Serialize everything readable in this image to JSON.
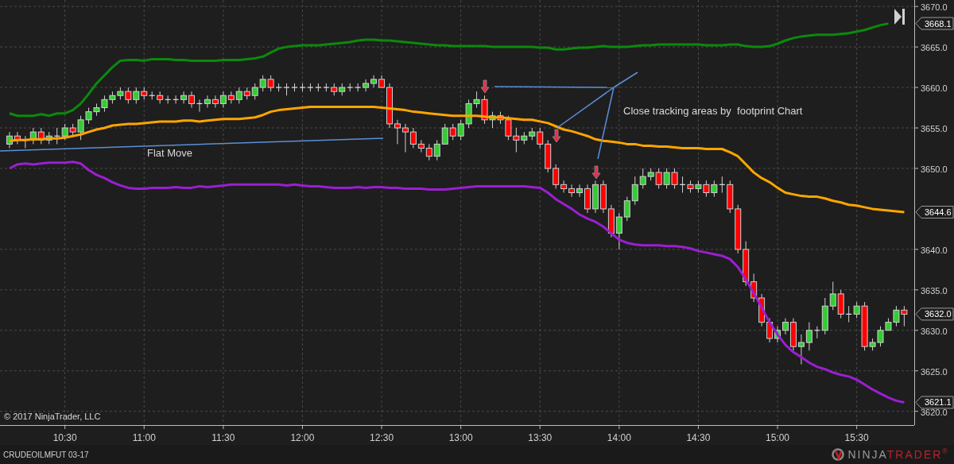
{
  "chart": {
    "copyright": "© 2017 NinjaTrader, LLC",
    "chart_data": {
      "type": "candlestick",
      "grid": true,
      "xlim": [
        605.4,
        951.8
      ],
      "ylim": [
        3618.3,
        3670.8
      ],
      "xticks": [
        {
          "value": 630,
          "label": "10:30"
        },
        {
          "value": 660,
          "label": "11:00"
        },
        {
          "value": 690,
          "label": "11:30"
        },
        {
          "value": 720,
          "label": "12:00"
        },
        {
          "value": 750,
          "label": "12:30"
        },
        {
          "value": 780,
          "label": "13:00"
        },
        {
          "value": 810,
          "label": "13:30"
        },
        {
          "value": 840,
          "label": "14:00"
        },
        {
          "value": 870,
          "label": "14:30"
        },
        {
          "value": 900,
          "label": "15:00"
        },
        {
          "value": 930,
          "label": "15:30"
        }
      ],
      "yticks": [
        {
          "value": 3620,
          "label": "3620.0"
        },
        {
          "value": 3625,
          "label": "3625.0"
        },
        {
          "value": 3630,
          "label": "3630.0"
        },
        {
          "value": 3635,
          "label": "3635.0"
        },
        {
          "value": 3640,
          "label": "3640.0"
        },
        {
          "value": 3650,
          "label": "3650.0"
        },
        {
          "value": 3655,
          "label": "3655.0"
        },
        {
          "value": 3660,
          "label": "3660.0"
        },
        {
          "value": 3665,
          "label": "3665.0"
        },
        {
          "value": 3670,
          "label": "3670.0"
        }
      ],
      "x": [
        609,
        612,
        615,
        618,
        621,
        624,
        627,
        630,
        633,
        636,
        639,
        642,
        645,
        648,
        651,
        654,
        657,
        660,
        663,
        666,
        669,
        672,
        675,
        678,
        681,
        684,
        687,
        690,
        693,
        696,
        699,
        702,
        705,
        708,
        711,
        714,
        717,
        720,
        723,
        726,
        729,
        732,
        735,
        738,
        741,
        744,
        747,
        750,
        753,
        756,
        759,
        762,
        765,
        768,
        771,
        774,
        777,
        780,
        783,
        786,
        789,
        792,
        795,
        798,
        801,
        804,
        807,
        810,
        813,
        816,
        819,
        822,
        825,
        828,
        831,
        834,
        837,
        840,
        843,
        846,
        849,
        852,
        855,
        858,
        861,
        864,
        867,
        870,
        873,
        876,
        879,
        882,
        885,
        888,
        891,
        894,
        897,
        900,
        903,
        906,
        909,
        912,
        915,
        918,
        921,
        924,
        927,
        930,
        933,
        936,
        939,
        942,
        945,
        948
      ],
      "ohlc": [
        [
          3653,
          3654.5,
          3652.5,
          3654
        ],
        [
          3654,
          3654.5,
          3653,
          3653.5
        ],
        [
          3653.5,
          3654,
          3652.5,
          3653.5
        ],
        [
          3653.5,
          3655,
          3653,
          3654.5
        ],
        [
          3654.5,
          3655,
          3653,
          3653.5
        ],
        [
          3653.5,
          3654.5,
          3653,
          3654
        ],
        [
          3654,
          3655,
          3653,
          3654
        ],
        [
          3654,
          3655.5,
          3653.5,
          3655
        ],
        [
          3655,
          3655.5,
          3654,
          3654.5
        ],
        [
          3654.5,
          3656.5,
          3653.5,
          3656
        ],
        [
          3656,
          3657.5,
          3655.5,
          3657
        ],
        [
          3657,
          3658,
          3656.5,
          3657.5
        ],
        [
          3657.5,
          3659,
          3657,
          3658.5
        ],
        [
          3658.5,
          3659.5,
          3658,
          3659
        ],
        [
          3659,
          3660,
          3658.5,
          3659.5
        ],
        [
          3659.5,
          3660,
          3658,
          3658.5
        ],
        [
          3658.5,
          3660,
          3658,
          3659.5
        ],
        [
          3659.5,
          3660,
          3658.5,
          3659
        ],
        [
          3659,
          3659.5,
          3658.5,
          3659
        ],
        [
          3659,
          3659.5,
          3658,
          3658.5
        ],
        [
          3658.5,
          3659,
          3658,
          3658.5
        ],
        [
          3658.5,
          3659,
          3658,
          3658.5
        ],
        [
          3658.5,
          3659.5,
          3658,
          3659
        ],
        [
          3659,
          3659.5,
          3657.5,
          3658
        ],
        [
          3658,
          3658.5,
          3657,
          3658
        ],
        [
          3658,
          3659,
          3657.5,
          3658.5
        ],
        [
          3658.5,
          3659,
          3657.5,
          3658
        ],
        [
          3658,
          3659.5,
          3657.5,
          3659
        ],
        [
          3659,
          3659.5,
          3658,
          3658.5
        ],
        [
          3658.5,
          3660,
          3658,
          3659.5
        ],
        [
          3659.5,
          3660,
          3658.5,
          3659
        ],
        [
          3659,
          3660.5,
          3658.5,
          3660
        ],
        [
          3660,
          3661.5,
          3659.5,
          3661
        ],
        [
          3661,
          3661.5,
          3659.5,
          3660
        ],
        [
          3660,
          3660.5,
          3659.5,
          3660
        ],
        [
          3660,
          3660.5,
          3659,
          3660
        ],
        [
          3660,
          3660.5,
          3659.5,
          3660
        ],
        [
          3660,
          3660.5,
          3659.5,
          3660
        ],
        [
          3660,
          3660.5,
          3659.5,
          3660
        ],
        [
          3660,
          3660.5,
          3659.5,
          3660
        ],
        [
          3660,
          3660.5,
          3659.5,
          3660
        ],
        [
          3660,
          3660.5,
          3659,
          3659.5
        ],
        [
          3659.5,
          3660.5,
          3659,
          3660
        ],
        [
          3660,
          3660.5,
          3659.5,
          3660
        ],
        [
          3660,
          3660.5,
          3659.5,
          3660
        ],
        [
          3660,
          3661,
          3659.5,
          3660.5
        ],
        [
          3660.5,
          3661.5,
          3660,
          3661
        ],
        [
          3661,
          3661.5,
          3660,
          3660
        ],
        [
          3660,
          3660.5,
          3655,
          3655.5
        ],
        [
          3655.5,
          3656,
          3653,
          3655
        ],
        [
          3655,
          3655.5,
          3652,
          3654.5
        ],
        [
          3654.5,
          3655,
          3652.5,
          3653
        ],
        [
          3653,
          3653.5,
          3652,
          3652.5
        ],
        [
          3652.5,
          3653,
          3651,
          3651.5
        ],
        [
          3651.5,
          3653.5,
          3651,
          3653
        ],
        [
          3653,
          3655.5,
          3653,
          3655
        ],
        [
          3655,
          3655.5,
          3653.5,
          3654
        ],
        [
          3654,
          3656,
          3653.5,
          3655.5
        ],
        [
          3655.5,
          3658.5,
          3655,
          3658
        ],
        [
          3658,
          3659.5,
          3657.5,
          3658.5
        ],
        [
          3658.5,
          3659,
          3655.5,
          3656
        ],
        [
          3656,
          3657,
          3655,
          3656.5
        ],
        [
          3656.5,
          3657,
          3655.5,
          3656
        ],
        [
          3656,
          3656.5,
          3653.5,
          3654
        ],
        [
          3654,
          3655,
          3652,
          3653.5
        ],
        [
          3653.5,
          3654.5,
          3653,
          3654
        ],
        [
          3654,
          3655,
          3653.5,
          3654.5
        ],
        [
          3654.5,
          3655,
          3652.5,
          3653
        ],
        [
          3653,
          3653.5,
          3649.5,
          3650
        ],
        [
          3650,
          3650.5,
          3647.5,
          3648
        ],
        [
          3648,
          3648.5,
          3647,
          3647.5
        ],
        [
          3647.5,
          3648,
          3646.5,
          3647
        ],
        [
          3647,
          3648,
          3646.5,
          3647.5
        ],
        [
          3647.5,
          3648,
          3644.5,
          3645
        ],
        [
          3645,
          3648.5,
          3644.5,
          3648
        ],
        [
          3648,
          3648.5,
          3644.5,
          3645
        ],
        [
          3645,
          3645.5,
          3641.5,
          3642
        ],
        [
          3642,
          3644.5,
          3640,
          3644
        ],
        [
          3644,
          3646.5,
          3643.5,
          3646
        ],
        [
          3646,
          3649,
          3645.5,
          3648
        ],
        [
          3648,
          3650,
          3647.5,
          3649
        ],
        [
          3649,
          3650,
          3648.5,
          3649.5
        ],
        [
          3649.5,
          3650,
          3647.5,
          3648
        ],
        [
          3648,
          3650,
          3647.5,
          3649.5
        ],
        [
          3649.5,
          3650,
          3647.5,
          3648
        ],
        [
          3648,
          3649,
          3647,
          3648
        ],
        [
          3648,
          3648.5,
          3647,
          3647.5
        ],
        [
          3647.5,
          3648.5,
          3647,
          3648
        ],
        [
          3648,
          3648.5,
          3646.5,
          3647
        ],
        [
          3647,
          3648.5,
          3646.5,
          3648
        ],
        [
          3648,
          3649,
          3647,
          3648
        ],
        [
          3648,
          3648.5,
          3644.5,
          3645
        ],
        [
          3645,
          3645.5,
          3639.5,
          3640
        ],
        [
          3640,
          3641,
          3635.5,
          3636
        ],
        [
          3636,
          3637,
          3633.5,
          3634
        ],
        [
          3634,
          3634.5,
          3630.5,
          3631
        ],
        [
          3631,
          3631.5,
          3628.5,
          3629
        ],
        [
          3629,
          3630.5,
          3628.5,
          3630
        ],
        [
          3630,
          3631.5,
          3629.5,
          3631
        ],
        [
          3631,
          3631.5,
          3627.5,
          3628
        ],
        [
          3628,
          3629.5,
          3625.8,
          3628.5
        ],
        [
          3628.5,
          3631,
          3627.5,
          3630
        ],
        [
          3630,
          3630.5,
          3629,
          3630
        ],
        [
          3630,
          3634,
          3629.5,
          3633
        ],
        [
          3633,
          3636,
          3632.5,
          3634.5
        ],
        [
          3634.5,
          3635,
          3631.5,
          3632
        ],
        [
          3632,
          3633,
          3631,
          3632
        ],
        [
          3632,
          3633.5,
          3631.5,
          3633
        ],
        [
          3633,
          3633.5,
          3627.5,
          3628
        ],
        [
          3628,
          3629,
          3627.5,
          3628.5
        ],
        [
          3628.5,
          3630.5,
          3628,
          3630
        ],
        [
          3630,
          3631.5,
          3630,
          3631
        ],
        [
          3631,
          3633,
          3630.5,
          3632.5
        ],
        [
          3632.5,
          3633,
          3630.5,
          3632
        ]
      ],
      "series": [
        {
          "type": "line",
          "color": "#0b8a0b",
          "values": [
            3656.8,
            3656.5,
            3656.5,
            3656.5,
            3656.7,
            3656.5,
            3656.8,
            3656.8,
            3657.2,
            3658,
            3659.2,
            3660.5,
            3661.5,
            3662.5,
            3663.3,
            3663.4,
            3663.4,
            3663.3,
            3663.5,
            3663.5,
            3663.5,
            3663.4,
            3663.4,
            3663.3,
            3663.3,
            3663.3,
            3663.3,
            3663.4,
            3663.4,
            3663.4,
            3663.5,
            3663.6,
            3663.8,
            3664.3,
            3664.8,
            3665,
            3665.1,
            3665.2,
            3665.2,
            3665.2,
            3665.3,
            3665.4,
            3665.5,
            3665.6,
            3665.8,
            3665.9,
            3665.9,
            3665.8,
            3665.8,
            3665.7,
            3665.6,
            3665.5,
            3665.4,
            3665.3,
            3665.2,
            3665.2,
            3665.1,
            3665.1,
            3665.1,
            3665.1,
            3665.1,
            3665,
            3665,
            3665,
            3665,
            3665,
            3665,
            3664.9,
            3664.9,
            3664.7,
            3664.7,
            3664.8,
            3664.9,
            3664.9,
            3665,
            3665.1,
            3665,
            3665,
            3665,
            3665.1,
            3665.2,
            3665.2,
            3665.3,
            3665.3,
            3665.3,
            3665.3,
            3665.3,
            3665.3,
            3665.2,
            3665.2,
            3665.2,
            3665.3,
            3665.3,
            3665.1,
            3665,
            3665,
            3665.1,
            3665.4,
            3665.8,
            3666.1,
            3666.3,
            3666.4,
            3666.5,
            3666.5,
            3666.5,
            3666.6,
            3666.7,
            3666.9,
            3667.1,
            3667.4,
            3667.7,
            3667.9,
            null,
            null
          ]
        },
        {
          "type": "line",
          "color": "#ffa500",
          "values": [
            3653.4,
            3653.5,
            3653.5,
            3653.6,
            3653.6,
            3653.7,
            3653.7,
            3653.8,
            3654,
            3654.2,
            3654.5,
            3654.8,
            3655,
            3655.3,
            3655.4,
            3655.5,
            3655.5,
            3655.6,
            3655.7,
            3655.8,
            3655.8,
            3655.8,
            3655.9,
            3655.9,
            3655.8,
            3655.9,
            3656,
            3656.1,
            3656.1,
            3656.1,
            3656.2,
            3656.3,
            3656.6,
            3657,
            3657.2,
            3657.3,
            3657.4,
            3657.5,
            3657.6,
            3657.6,
            3657.6,
            3657.6,
            3657.6,
            3657.6,
            3657.6,
            3657.6,
            3657.6,
            3657.5,
            3657.4,
            3657.3,
            3657.2,
            3657,
            3656.9,
            3656.8,
            3656.7,
            3656.6,
            3656.5,
            3656.5,
            3656.5,
            3656.5,
            3656.4,
            3656.3,
            3656.3,
            3656.2,
            3656.1,
            3656,
            3656,
            3655.8,
            3655.6,
            3655.2,
            3654.8,
            3654.6,
            3654.3,
            3654,
            3653.6,
            3653.4,
            3653.3,
            3653.2,
            3653,
            3653,
            3652.8,
            3652.8,
            3652.7,
            3652.7,
            3652.6,
            3652.5,
            3652.5,
            3652.5,
            3652.4,
            3652.4,
            3652.4,
            3652,
            3651.5,
            3650.5,
            3649.5,
            3648.8,
            3648.3,
            3647.6,
            3647,
            3646.8,
            3646.6,
            3646.5,
            3646.5,
            3646.3,
            3646,
            3645.8,
            3645.5,
            3645.4,
            3645.2,
            3645,
            3644.9,
            3644.8,
            3644.7,
            3644.6
          ]
        },
        {
          "type": "line",
          "color": "#9b1fd1",
          "values": [
            3650,
            3650.5,
            3650.6,
            3650.5,
            3650.6,
            3650.7,
            3650.7,
            3650.7,
            3650.8,
            3650.6,
            3649.8,
            3649.2,
            3648.8,
            3648.3,
            3647.9,
            3647.6,
            3647.5,
            3647.5,
            3647.6,
            3647.6,
            3647.6,
            3647.7,
            3647.6,
            3647.6,
            3647.8,
            3647.7,
            3647.8,
            3647.9,
            3648,
            3648,
            3648,
            3648,
            3648,
            3648,
            3648,
            3647.9,
            3648,
            3647.9,
            3647.8,
            3647.8,
            3647.7,
            3647.6,
            3647.6,
            3647.6,
            3647.7,
            3647.6,
            3647.7,
            3647.7,
            3647.6,
            3647.6,
            3647.5,
            3647.5,
            3647.5,
            3647.4,
            3647.4,
            3647.4,
            3647.5,
            3647.6,
            3647.7,
            3647.8,
            3647.8,
            3647.8,
            3647.8,
            3647.8,
            3647.8,
            3647.8,
            3647.7,
            3647.6,
            3647,
            3646.2,
            3645.6,
            3645,
            3644.3,
            3643.8,
            3643.4,
            3642.8,
            3642,
            3641.2,
            3640.8,
            3640.6,
            3640.5,
            3640.5,
            3640.5,
            3640.4,
            3640.4,
            3640.3,
            3640.1,
            3639.8,
            3639.6,
            3639.4,
            3639.2,
            3638.8,
            3637.8,
            3636.3,
            3634.6,
            3632.8,
            3631,
            3629.5,
            3628.2,
            3627.3,
            3626.7,
            3626,
            3625.5,
            3625.2,
            3624.8,
            3624.5,
            3624.3,
            3623.9,
            3623.3,
            3622.7,
            3622.2,
            3621.7,
            3621.3,
            3621.1
          ]
        }
      ],
      "annotations": [
        "Flat Move",
        "Close tracking areas by  footprint Chart"
      ]
    },
    "price_tags": [
      "3668.1",
      "3644.6",
      "3632.0",
      "3621.1"
    ]
  },
  "footer": {
    "instrument": "CRUDEOILMFUT 03-17",
    "logo": [
      "NINJA",
      "TRADER",
      "®"
    ]
  }
}
